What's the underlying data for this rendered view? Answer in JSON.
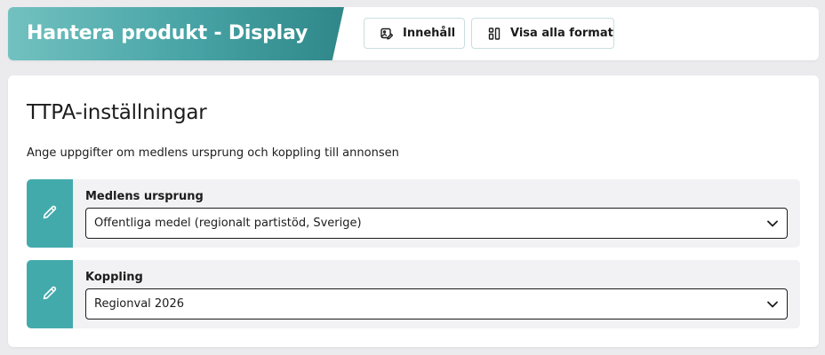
{
  "header": {
    "title": "Hantera produkt - Display",
    "buttons": [
      {
        "label": "Innehåll",
        "icon": "image-edit-icon"
      },
      {
        "label": "Visa alla format",
        "icon": "formats-icon"
      }
    ]
  },
  "section": {
    "title": "TTPA-inställningar",
    "description": "Ange uppgifter om medlens ursprung och koppling till annonsen"
  },
  "fields": [
    {
      "label": "Medlens ursprung",
      "value": "Offentliga medel (regionalt partistöd, Sverige)"
    },
    {
      "label": "Koppling",
      "value": "Regionval 2026"
    }
  ],
  "colors": {
    "banner_start": "#72c1c0",
    "banner_end": "#2f8789",
    "accent": "#43aaac",
    "page_bg": "#ebebed"
  }
}
